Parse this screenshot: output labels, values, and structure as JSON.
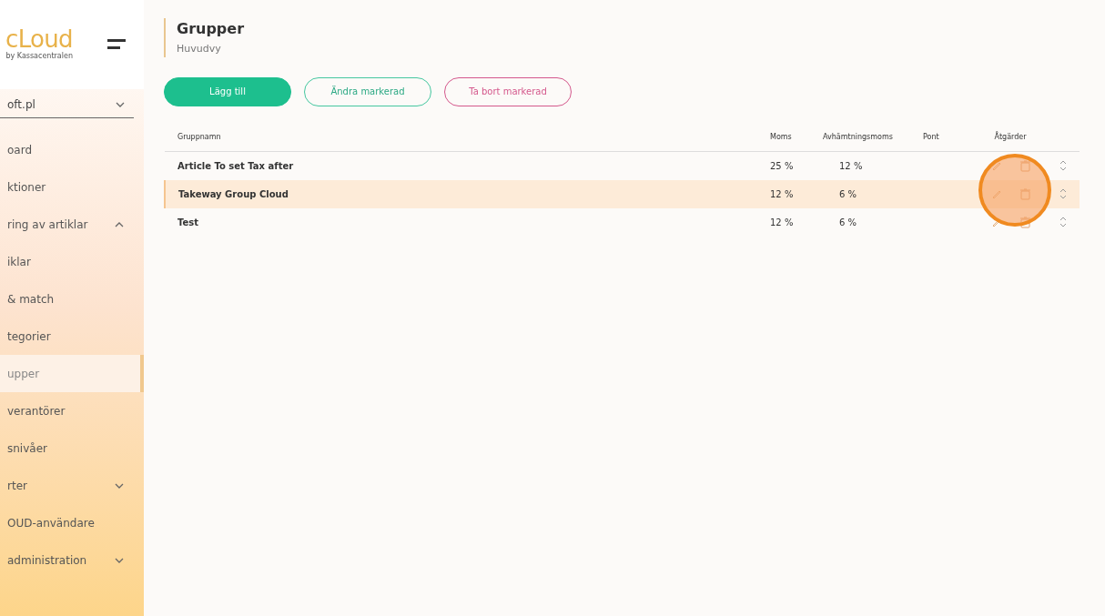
{
  "sidebar": {
    "logo": {
      "text": "cLoud",
      "byline": "by Kassacentralen"
    },
    "account": {
      "label": "oft.pl",
      "expanded": false
    },
    "items": [
      {
        "label": "oard",
        "selected": false
      },
      {
        "label": "ktioner",
        "selected": false
      },
      {
        "label": "ring av artiklar",
        "selected": false,
        "expanded": true
      },
      {
        "label": "iklar",
        "selected": false
      },
      {
        "label": "& match",
        "selected": false
      },
      {
        "label": "tegorier",
        "selected": false
      },
      {
        "label": "upper",
        "selected": true
      },
      {
        "label": "verantörer",
        "selected": false
      },
      {
        "label": "snivåer",
        "selected": false
      },
      {
        "label": "rter",
        "selected": false,
        "expanded": false
      },
      {
        "label": "OUD-användare",
        "selected": false
      },
      {
        "label": "administration",
        "selected": false,
        "expanded": false
      }
    ]
  },
  "header": {
    "title": "Grupper",
    "subtitle": "Huvudvy"
  },
  "buttons": [
    {
      "label": "Lägg till",
      "kind": "primary"
    },
    {
      "label": "Ändra markerad",
      "kind": "outline"
    },
    {
      "label": "Ta bort markerad",
      "kind": "danger"
    }
  ],
  "table": {
    "columns": [
      "Gruppnamn",
      "Moms",
      "Avhämtningsmoms",
      "Pont",
      "Åtgärder"
    ],
    "rows": [
      {
        "name": "Article To set Tax after",
        "moms": "25 %",
        "avh": "12 %",
        "selected": false
      },
      {
        "name": "Takeway Group Cloud",
        "moms": "12 %",
        "avh": "6 %",
        "selected": true
      },
      {
        "name": "Test",
        "moms": "12 %",
        "avh": "6 %",
        "selected": false
      }
    ]
  }
}
